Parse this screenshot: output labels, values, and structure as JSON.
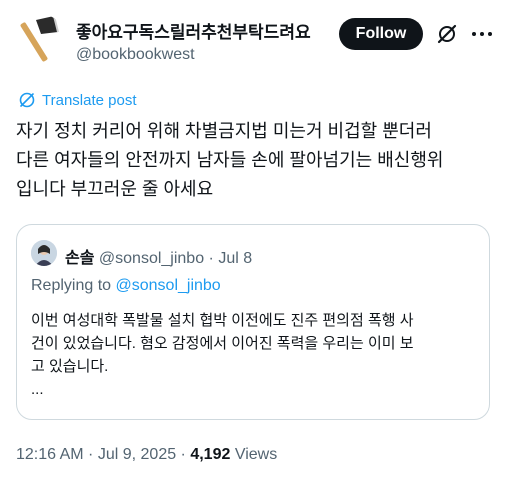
{
  "author": {
    "display_name": "좋아요구독스릴러추천부탁드려요",
    "handle": "@bookbookwest",
    "avatar_icon": "axe-icon"
  },
  "actions": {
    "follow_label": "Follow",
    "grok_icon": "grok-slash-icon",
    "more_icon": "more-dots-icon"
  },
  "translate": {
    "label": "Translate post",
    "icon": "globe-icon"
  },
  "tweet": {
    "lines": [
      "자기 정치 커리어 위해 차별금지법 미는거 비겁할 뿐더러",
      "다른 여자들의 안전까지 남자들 손에 팔아넘기는 배신행위",
      "입니다 부끄러운 줄 아세요"
    ]
  },
  "quote": {
    "name": "손솔",
    "handle": "@sonsol_jinbo",
    "separator": " · ",
    "date": "Jul 8",
    "replying_prefix": "Replying to ",
    "replying_handle": "@sonsol_jinbo",
    "lines": [
      "이번 여성대학 폭발물 설치 협박 이전에도 진주 편의점 폭행 사",
      "건이 있었습니다. 혐오 감정에서 이어진 폭력을 우리는 이미 보",
      "고 있습니다.",
      "..."
    ]
  },
  "meta": {
    "time": "12:16 AM",
    "date": "Jul 9, 2025",
    "separator": " · ",
    "views_count": "4,192",
    "views_label": " Views"
  },
  "colors": {
    "text": "#0f1419",
    "secondary": "#536471",
    "link": "#1d9bf0",
    "border": "#cfd9de",
    "follow_bg": "#0f1419"
  }
}
